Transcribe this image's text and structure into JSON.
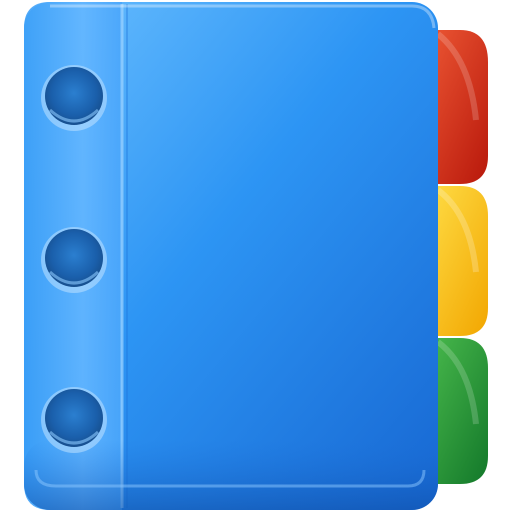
{
  "icon": {
    "name": "address-book-icon",
    "colors": {
      "cover_light": "#5fb4ff",
      "cover_mid": "#2b91f2",
      "cover_dark": "#1769d6",
      "cover_edge": "#1a5fb8",
      "ring_hole": "#1c5fa8",
      "tab_red": "#e23b20",
      "tab_red_dark": "#b3190c",
      "tab_yellow": "#ffcf1c",
      "tab_yellow_dark": "#f0a500",
      "tab_green": "#2fa83a",
      "tab_green_dark": "#14802a"
    },
    "tabs": [
      "red",
      "yellow",
      "green"
    ],
    "rings": 3
  }
}
